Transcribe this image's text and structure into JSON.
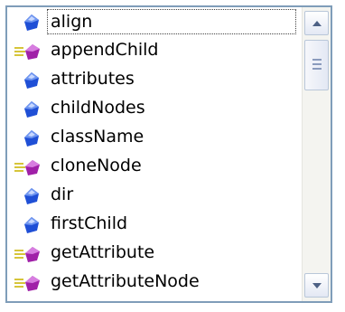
{
  "items": [
    {
      "label": "align",
      "kind": "property",
      "icon": "property-icon",
      "selected": true
    },
    {
      "label": "appendChild",
      "kind": "method",
      "icon": "method-icon",
      "selected": false
    },
    {
      "label": "attributes",
      "kind": "property",
      "icon": "property-icon",
      "selected": false
    },
    {
      "label": "childNodes",
      "kind": "property",
      "icon": "property-icon",
      "selected": false
    },
    {
      "label": "className",
      "kind": "property",
      "icon": "property-icon",
      "selected": false
    },
    {
      "label": "cloneNode",
      "kind": "method",
      "icon": "method-icon",
      "selected": false
    },
    {
      "label": "dir",
      "kind": "property",
      "icon": "property-icon",
      "selected": false
    },
    {
      "label": "firstChild",
      "kind": "property",
      "icon": "property-icon",
      "selected": false
    },
    {
      "label": "getAttribute",
      "kind": "method",
      "icon": "method-icon",
      "selected": false
    },
    {
      "label": "getAttributeNode",
      "kind": "method",
      "icon": "method-icon",
      "selected": false
    }
  ],
  "colors": {
    "border": "#7f9db9",
    "property_icon": "#1f4fd6",
    "method_icon": "#a020a8",
    "method_lines": "#d6c53a"
  }
}
